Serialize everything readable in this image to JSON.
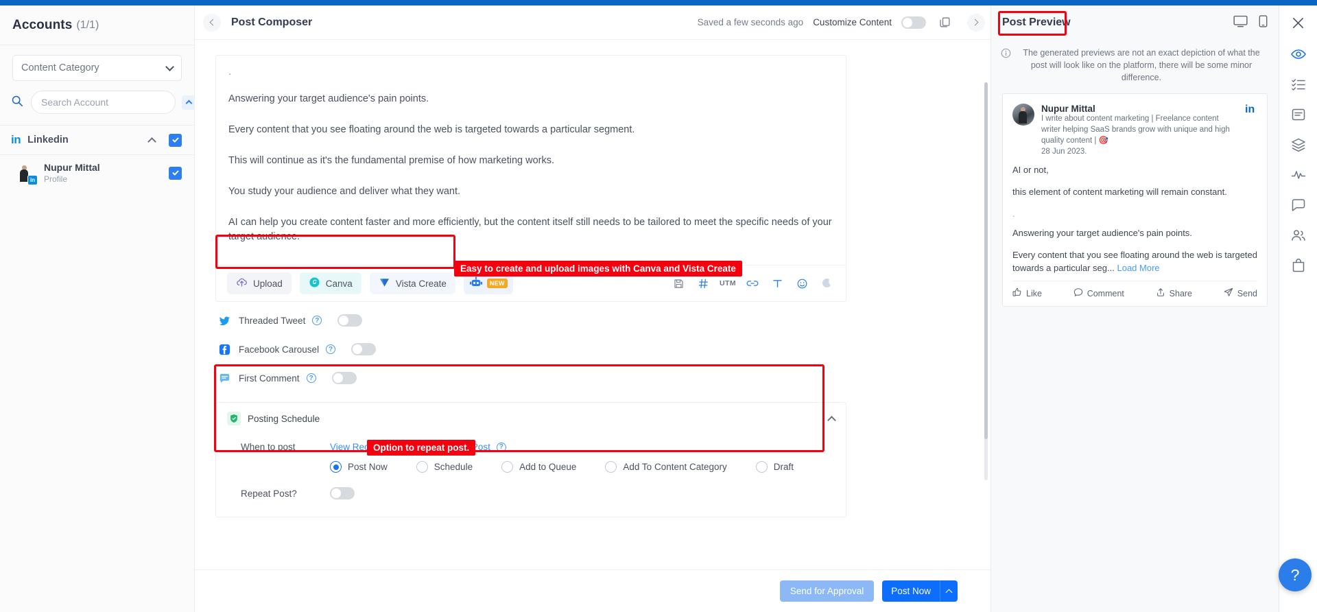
{
  "sidebar": {
    "title": "Accounts",
    "count": "(1/1)",
    "content_category_placeholder": "Content Category",
    "search_placeholder": "Search Account",
    "platform": {
      "logo": "in",
      "name": "Linkedin"
    },
    "account": {
      "name": "Nupur Mittal",
      "subtitle": "Profile",
      "badge": "in"
    }
  },
  "header": {
    "title": "Post Composer",
    "saved_status": "Saved a few seconds ago",
    "customize_content": "Customize Content"
  },
  "editor": {
    "paragraphs": [
      ".",
      "Answering your target audience's pain points.",
      "Every content that you see floating around the web is targeted towards a particular segment.",
      "This will continue as it's the fundamental premise of how marketing works.",
      "You study your audience and deliver what they want.",
      "AI can help you create content faster and more efficiently, but the content itself still needs to be tailored to meet the specific needs of your target audience."
    ]
  },
  "media_bar": {
    "upload": "Upload",
    "canva": "Canva",
    "vista": "Vista Create",
    "ai_badge": "NEW",
    "utm": "UTM",
    "icons": [
      "save-icon",
      "hashtag-icon",
      "utm-icon",
      "link-icon",
      "text-format-icon",
      "emoji-icon",
      "ai-sparkle-icon"
    ]
  },
  "options": [
    {
      "label": "Threaded Tweet",
      "icon": "twitter-icon",
      "enabled": false
    },
    {
      "label": "Facebook Carousel",
      "icon": "facebook-icon",
      "enabled": false
    },
    {
      "label": "First Comment",
      "icon": "comment-icon",
      "enabled": false
    }
  ],
  "schedule": {
    "title": "Posting Schedule",
    "when_label": "When to post",
    "recommend_link": "View Recommended Best Time to Post",
    "radios": [
      {
        "label": "Post Now",
        "selected": true
      },
      {
        "label": "Schedule",
        "selected": false
      },
      {
        "label": "Add to Queue",
        "selected": false
      },
      {
        "label": "Add To Content Category",
        "selected": false
      },
      {
        "label": "Draft",
        "selected": false
      }
    ],
    "repeat_label": "Repeat Post?",
    "repeat_enabled": false
  },
  "annotations": [
    {
      "text": "Easy to create and upload images with Canva and Vista Create"
    },
    {
      "text": "Option to repeat post."
    }
  ],
  "footer": {
    "send_for_approval": "Send for Approval",
    "post_now": "Post Now"
  },
  "preview": {
    "title": "Post Preview",
    "note": "The generated previews are not an exact depiction of what the post will look like on the platform, there will be some minor difference.",
    "author": {
      "name": "Nupur Mittal",
      "bio": "I write about content marketing | Freelance content writer helping SaaS brands grow with unique and high quality content | 🎯",
      "date": "28 Jun 2023."
    },
    "paragraphs": [
      "AI or not,",
      "this element of content marketing will remain constant.",
      ".",
      "Answering your target audience's pain points."
    ],
    "truncated": "Every content that you see floating around the web is targeted towards a particular seg...",
    "load_more": "Load More",
    "actions": [
      "Like",
      "Comment",
      "Share",
      "Send"
    ]
  },
  "rail": {
    "help": "?",
    "icons": [
      "close-icon",
      "preview-eye-icon",
      "checklist-icon",
      "document-icon",
      "stack-icon",
      "analytics-icon",
      "feedback-icon",
      "users-icon",
      "bag-icon"
    ]
  },
  "colors": {
    "accent": "#0d6efd",
    "annotation_red": "#f5000f",
    "link": "#3b8fe8"
  }
}
